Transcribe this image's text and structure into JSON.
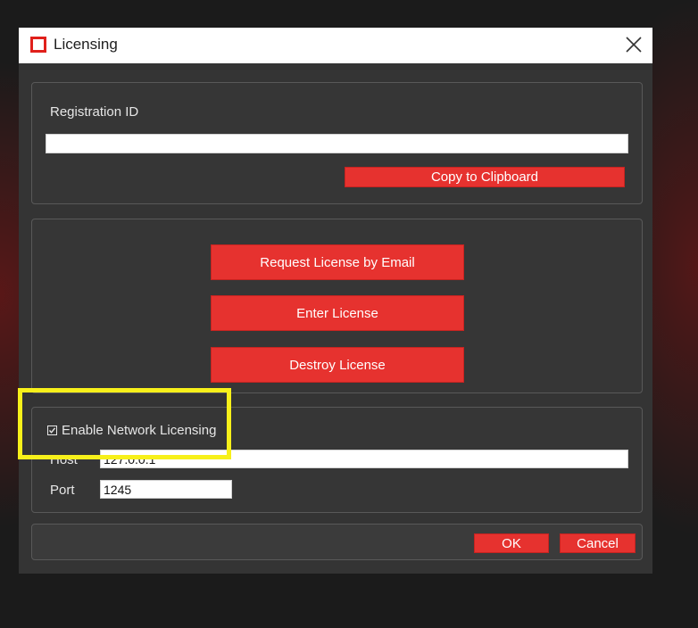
{
  "dialog": {
    "title": "Licensing",
    "close_icon": "close-icon",
    "app_icon": "app-logo-icon"
  },
  "registration": {
    "label": "Registration ID",
    "value": "",
    "copy_label": "Copy to Clipboard"
  },
  "actions": {
    "request_email_label": "Request License by Email",
    "enter_license_label": "Enter License",
    "destroy_license_label": "Destroy License"
  },
  "network": {
    "enable_label": "Enable Network Licensing",
    "enabled": true,
    "host_label": "Host",
    "host_value": "127.0.0.1",
    "port_label": "Port",
    "port_value": "1245"
  },
  "footer": {
    "ok_label": "OK",
    "cancel_label": "Cancel"
  },
  "colors": {
    "accent": "#e6322f",
    "dialog_bg": "#343434",
    "annotation_highlight": "#f7f01a"
  }
}
